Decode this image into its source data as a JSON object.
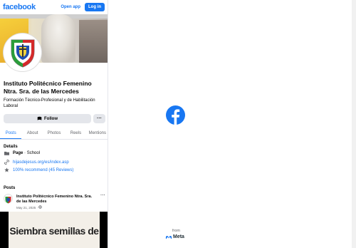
{
  "topbar": {
    "logo": "facebook",
    "open_app": "Open app",
    "login": "Log in"
  },
  "page": {
    "name": "Instituto Politécnico Femenino Ntra. Sra. de las Mercedes",
    "description": "Formación Técnico-Profesional y de Habilitación Laboral",
    "follow_label": "Follow",
    "more_label": "···"
  },
  "tabs": [
    "Posts",
    "About",
    "Photos",
    "Reels",
    "Mentions"
  ],
  "details": {
    "heading": "Details",
    "page_label": "Page",
    "page_type": "School",
    "website": "hijasdejesus.org/es/index.asp",
    "recommend": "100% recommend (45 Reviews)"
  },
  "posts": {
    "heading": "Posts",
    "author": "Instituto Politécnico Femenino Ntra. Sra. de las Mercedes",
    "date": "May 21, 2025 ·",
    "more_label": "···",
    "image_text": "Siembra semillas de"
  },
  "footer": {
    "from": "from",
    "meta": "Meta"
  },
  "colors": {
    "brand": "#1877f2",
    "button_bg": "#e4e6eb",
    "muted": "#65676b"
  },
  "icons": [
    "follow-icon",
    "page-icon",
    "link-icon",
    "star-icon",
    "globe-icon",
    "facebook-logo-icon",
    "meta-logo-icon"
  ]
}
